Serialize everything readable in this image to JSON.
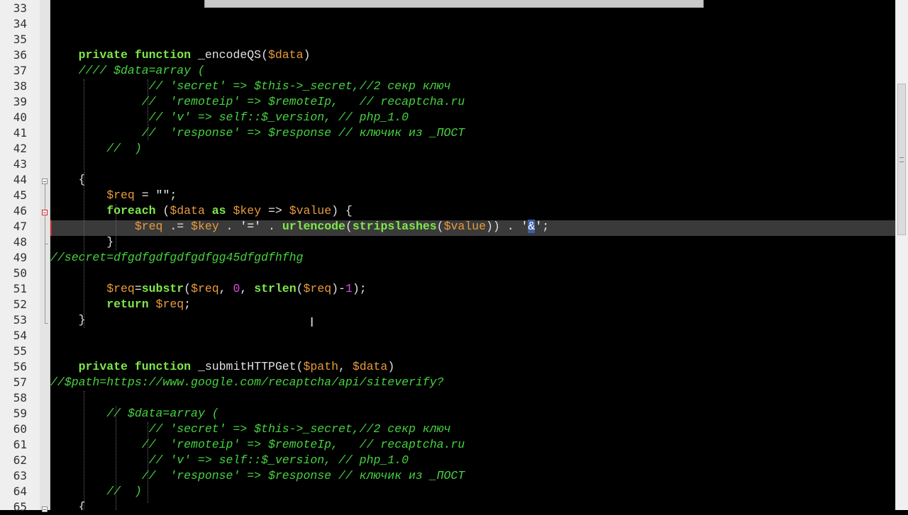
{
  "lines": [
    {
      "n": "33",
      "html": ""
    },
    {
      "n": "34",
      "html": ""
    },
    {
      "n": "35",
      "html": ""
    },
    {
      "n": "36",
      "html": "    <span class=\"kw\">private</span> <span class=\"kw\">function</span> _encodeQS(<span class=\"var\">$data</span>)"
    },
    {
      "n": "37",
      "html": "    <span class=\"cm\">//// $data=array (</span>"
    },
    {
      "n": "38",
      "html": "              <span class=\"cm\">// 'secret' => $this->_secret,//2 секр ключ</span>"
    },
    {
      "n": "39",
      "html": "             <span class=\"cm\">//  'remoteip' => $remoteIp,   // recaptcha.ru</span>"
    },
    {
      "n": "40",
      "html": "              <span class=\"cm\">// 'v' => self::$_version, // php_1.0</span>"
    },
    {
      "n": "41",
      "html": "             <span class=\"cm\">//  'response' => $response // ключик из _ПОСТ</span>"
    },
    {
      "n": "42",
      "html": "        <span class=\"cm\">//  )</span>"
    },
    {
      "n": "43",
      "html": ""
    },
    {
      "n": "44",
      "html": "    {"
    },
    {
      "n": "45",
      "html": "        <span class=\"var\">$req</span> = <span class=\"str\">\"\"</span>;"
    },
    {
      "n": "46",
      "html": "        <span class=\"kw\">foreach</span> (<span class=\"var\">$data</span> <span class=\"kw\">as</span> <span class=\"var\">$key</span> => <span class=\"var\">$value</span>) {"
    },
    {
      "n": "47",
      "html": "            <span class=\"var\">$req</span> .= <span class=\"var\">$key</span> . <span class=\"str\">'='</span> . <span class=\"fn\">urlencode</span>(<span class=\"fn\">stripslashes</span>(<span class=\"var\">$value</span>)) . <span class=\"str\">'<span class=\"sel\">&amp;</span>'</span>;"
    },
    {
      "n": "48",
      "html": "        }"
    },
    {
      "n": "49",
      "html": "<span class=\"cm\">//secret=dfgdfgdfgdfgdfgg45dfgdfhfhg</span>"
    },
    {
      "n": "50",
      "html": ""
    },
    {
      "n": "51",
      "html": "        <span class=\"var\">$req</span>=<span class=\"fn\">substr</span>(<span class=\"var\">$req</span>, <span class=\"num\">0</span>, <span class=\"fn\">strlen</span>(<span class=\"var\">$req</span>)-<span class=\"num\">1</span>);"
    },
    {
      "n": "52",
      "html": "        <span class=\"kw\">return</span> <span class=\"var\">$req</span>;"
    },
    {
      "n": "53",
      "html": "    }"
    },
    {
      "n": "54",
      "html": ""
    },
    {
      "n": "55",
      "html": ""
    },
    {
      "n": "56",
      "html": "    <span class=\"kw\">private</span> <span class=\"kw\">function</span> _submitHTTPGet(<span class=\"var\">$path</span>, <span class=\"var\">$data</span>)"
    },
    {
      "n": "57",
      "html": "<span class=\"cm\">//$path=https://www.google.com/recaptcha/api/siteverify?</span>"
    },
    {
      "n": "58",
      "html": ""
    },
    {
      "n": "59",
      "html": "        <span class=\"cm\">// $data=array (</span>"
    },
    {
      "n": "60",
      "html": "              <span class=\"cm\">// 'secret' => $this->_secret,//2 секр ключ</span>"
    },
    {
      "n": "61",
      "html": "             <span class=\"cm\">//  'remoteip' => $remoteIp,   // recaptcha.ru</span>"
    },
    {
      "n": "62",
      "html": "              <span class=\"cm\">// 'v' => self::$_version, // php_1.0</span>"
    },
    {
      "n": "63",
      "html": "             <span class=\"cm\">//  'response' => $response // ключик из _ПОСТ</span>"
    },
    {
      "n": "64",
      "html": "        <span class=\"cm\">//  )</span>"
    },
    {
      "n": "65",
      "html": "    {"
    }
  ]
}
